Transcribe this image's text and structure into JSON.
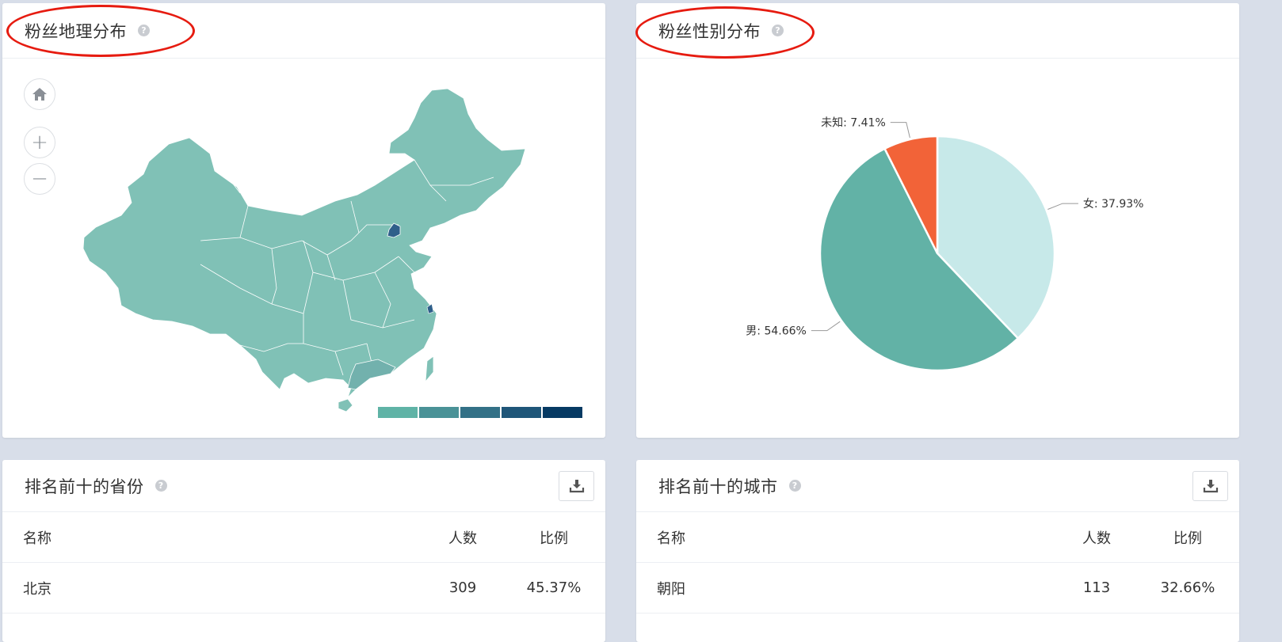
{
  "geo": {
    "title": "粉丝地理分布",
    "help": "?",
    "controls": {
      "home": "⌂",
      "zoom_in": "+",
      "zoom_out": "−"
    },
    "colors": {
      "base": "#80c1b6",
      "beijing": "#2f5f8a",
      "guangdong": "#72b1ad",
      "border": "#ffffff"
    },
    "legend": [
      "#5fb3a6",
      "#4a9297",
      "#337187",
      "#1f5679",
      "#063a63"
    ]
  },
  "gender": {
    "title": "粉丝性别分布",
    "help": "?",
    "chart_data": {
      "type": "pie",
      "slices": [
        {
          "label": "女",
          "value": 37.93,
          "text": "女: 37.93%",
          "color": "#c7e9e9"
        },
        {
          "label": "男",
          "value": 54.66,
          "text": "男: 54.66%",
          "color": "#62b2a6"
        },
        {
          "label": "未知",
          "value": 7.41,
          "text": "未知: 7.41%",
          "color": "#f26338"
        }
      ],
      "start_angle_deg": 0,
      "direction": "clockwise"
    }
  },
  "provinces": {
    "title": "排名前十的省份",
    "help": "?",
    "columns": {
      "name": "名称",
      "count": "人数",
      "ratio": "比例"
    },
    "rows": [
      {
        "name": "北京",
        "count": "309",
        "ratio": "45.37%"
      }
    ]
  },
  "cities": {
    "title": "排名前十的城市",
    "help": "?",
    "columns": {
      "name": "名称",
      "count": "人数",
      "ratio": "比例"
    },
    "rows": [
      {
        "name": "朝阳",
        "count": "113",
        "ratio": "32.66%"
      }
    ]
  }
}
